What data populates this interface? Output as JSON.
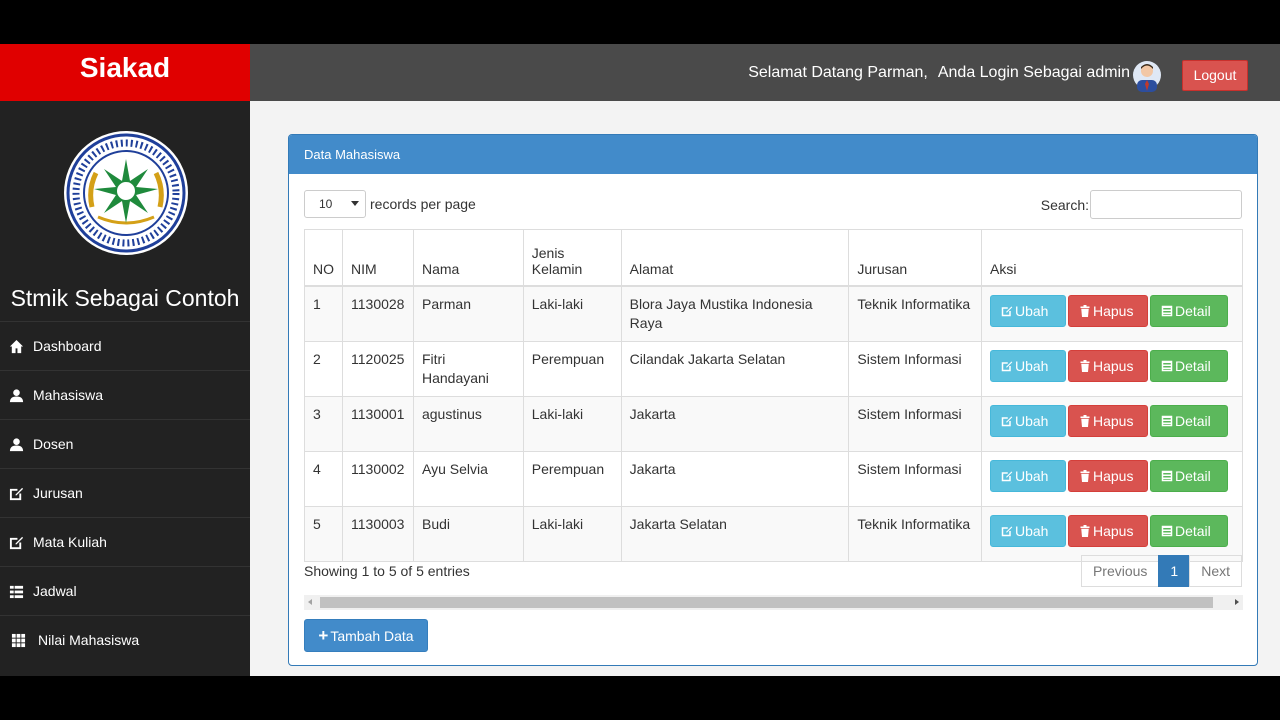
{
  "header": {
    "brand": "Siakad",
    "welcome": "Selamat Datang Parman,",
    "role": "Anda Login Sebagai admin",
    "logout_label": "Logout"
  },
  "sidebar": {
    "site_name": "Stmik Sebagai Contoh",
    "items": [
      {
        "label": "Dashboard",
        "icon": "home-icon"
      },
      {
        "label": "Mahasiswa",
        "icon": "user-icon"
      },
      {
        "label": "Dosen",
        "icon": "user-icon"
      },
      {
        "label": "Jurusan",
        "icon": "edit-icon"
      },
      {
        "label": "Mata Kuliah",
        "icon": "edit-icon"
      },
      {
        "label": "Jadwal",
        "icon": "list-icon"
      },
      {
        "label": "Nilai Mahasiswa",
        "icon": "grid-icon"
      }
    ]
  },
  "panel": {
    "title": "Data Mahasiswa",
    "length_value": "10",
    "length_suffix": "records per page",
    "search_label": "Search:",
    "search_value": "",
    "columns": [
      "NO",
      "NIM",
      "Nama",
      "Jenis Kelamin",
      "Alamat",
      "Jurusan",
      "Aksi"
    ],
    "rows": [
      {
        "no": "1",
        "nim": "1130028",
        "nama": "Parman",
        "jk": "Laki-laki",
        "alamat": "Blora Jaya Mustika Indonesia Raya",
        "jurusan": "Teknik Informatika"
      },
      {
        "no": "2",
        "nim": "1120025",
        "nama": "Fitri Handayani",
        "jk": "Perempuan",
        "alamat": "Cilandak Jakarta Selatan",
        "jurusan": "Sistem Informasi"
      },
      {
        "no": "3",
        "nim": "1130001",
        "nama": "agustinus",
        "jk": "Laki-laki",
        "alamat": "Jakarta",
        "jurusan": "Sistem Informasi"
      },
      {
        "no": "4",
        "nim": "1130002",
        "nama": "Ayu Selvia",
        "jk": "Perempuan",
        "alamat": "Jakarta",
        "jurusan": "Sistem Informasi"
      },
      {
        "no": "5",
        "nim": "1130003",
        "nama": "Budi",
        "jk": "Laki-laki",
        "alamat": "Jakarta Selatan",
        "jurusan": "Teknik Informatika"
      }
    ],
    "actions": {
      "edit": "Ubah",
      "delete": "Hapus",
      "detail": "Detail"
    },
    "info": "Showing 1 to 5 of 5 entries",
    "pagination": {
      "prev": "Previous",
      "current": "1",
      "next": "Next"
    },
    "add_label": "Tambah Data"
  },
  "colors": {
    "brand": "#e00000",
    "topbar": "#4a4a4a",
    "sidebar": "#222222",
    "primary": "#428bca",
    "info": "#5bc0de",
    "danger": "#d9534f",
    "success": "#5cb85c"
  }
}
